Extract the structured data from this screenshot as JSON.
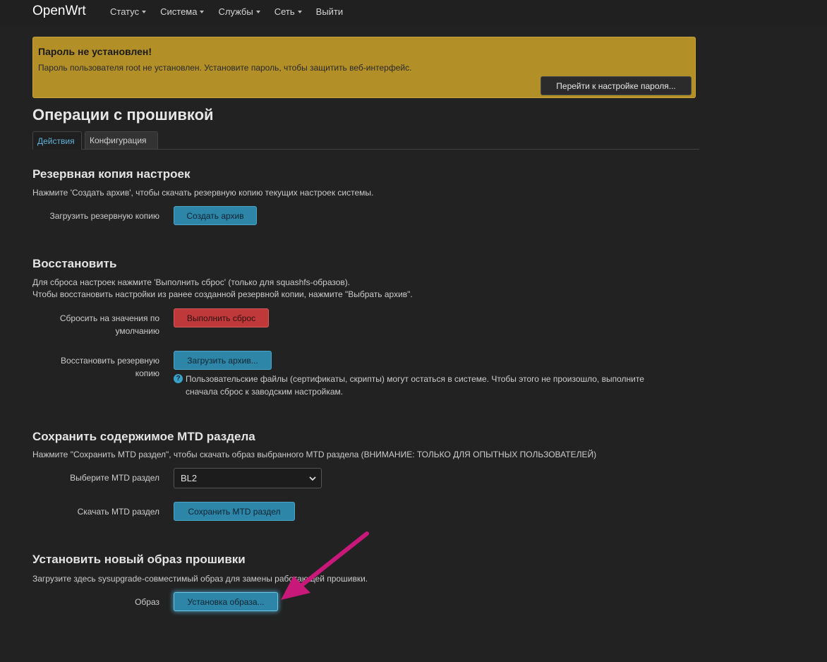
{
  "navbar": {
    "brand": "OpenWrt",
    "menu": [
      {
        "label": "Статус",
        "dropdown": true
      },
      {
        "label": "Система",
        "dropdown": true
      },
      {
        "label": "Службы",
        "dropdown": true
      },
      {
        "label": "Сеть",
        "dropdown": true
      },
      {
        "label": "Выйти",
        "dropdown": false
      }
    ]
  },
  "alert": {
    "title": "Пароль не установлен!",
    "text": "Пароль пользователя root не установлен. Установите пароль, чтобы защитить веб-интерфейс.",
    "button_label": "Перейти к настройке пароля..."
  },
  "page": {
    "title": "Операции с прошивкой",
    "tabs": [
      {
        "label": "Действия",
        "active": true
      },
      {
        "label": "Конфигурация",
        "active": false
      }
    ]
  },
  "backup": {
    "title": "Резервная копия настроек",
    "description": "Нажмите 'Создать архив', чтобы скачать резервную копию текущих настроек системы.",
    "field_label": "Загрузить резервную копию",
    "button_label": "Создать архив"
  },
  "restore": {
    "title": "Восстановить",
    "description_line1": "Для сброса настроек нажмите 'Выполнить сброс' (только для squashfs-образов).",
    "description_line2": "Чтобы восстановить настройки из ранее созданной резервной копии, нажмите \"Выбрать архив\".",
    "reset_label_line1": "Сбросить на значения по",
    "reset_label_line2": "умолчанию",
    "reset_button": "Выполнить сброс",
    "restore_label_line1": "Восстановить резервную",
    "restore_label_line2": "копию",
    "upload_button": "Загрузить архив...",
    "help_line1": "Пользовательские файлы (сертификаты, скрипты) могут остаться в системе. Чтобы этого не произошло, выполните",
    "help_line2": "сначала сброс к заводским настройкам."
  },
  "mtd": {
    "title": "Сохранить содержимое MTD раздела",
    "description": "Нажмите \"Сохранить MTD раздел\", чтобы скачать образ выбранного MTD раздела (ВНИМАНИЕ: ТОЛЬКО ДЛЯ ОПЫТНЫХ ПОЛЬЗОВАТЕЛЕЙ)",
    "select_label": "Выберите MTD раздел",
    "select_value": "BL2",
    "download_label": "Скачать MTD раздел",
    "save_button": "Сохранить MTD раздел"
  },
  "flash": {
    "title": "Установить новый образ прошивки",
    "description": "Загрузите здесь sysupgrade-совместимый образ для замены работающей прошивки.",
    "image_label": "Образ",
    "install_button": "Установка образа..."
  },
  "colors": {
    "background": "#222222",
    "alert": "#b28f27",
    "primary_button": "#2d86a8",
    "danger_button": "#c0393a",
    "annotation_arrow": "#c8197a",
    "active_tab_text": "#5fb2d8"
  }
}
